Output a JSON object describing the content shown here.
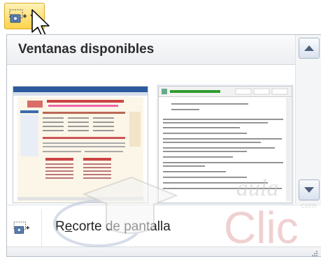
{
  "toolbar": {
    "button_icon": "screenshot-icon",
    "dropdown_icon": "chevron-down-icon"
  },
  "panel": {
    "title": "Ventanas disponibles",
    "thumbnails": [
      {
        "kind": "web-page-preview"
      },
      {
        "kind": "text-editor-preview"
      }
    ],
    "menu_item": {
      "label_prefix": "R",
      "label_underlined": "e",
      "label_rest": "corte de pantalla"
    }
  },
  "watermark": {
    "text_small": "aula",
    "text_big": "Clic",
    "text_tiny": "com"
  },
  "colors": {
    "button_gold": "#ffd24a",
    "scroll_arrow": "#4d5f7b",
    "watermark_red": "#e8c3c3"
  }
}
